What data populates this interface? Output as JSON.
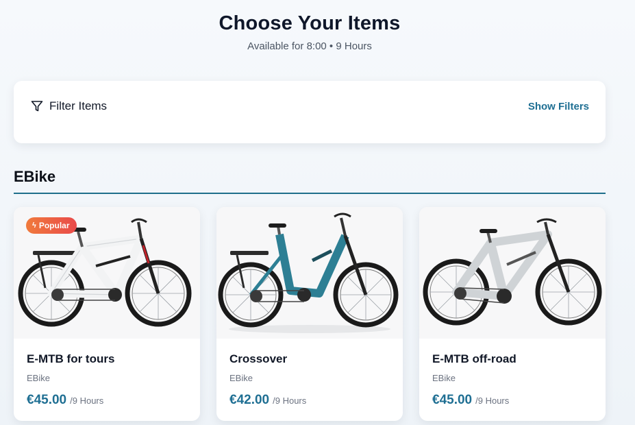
{
  "header": {
    "title": "Choose Your Items",
    "subtitle": "Available for 8:00 • 9 Hours"
  },
  "filter": {
    "label": "Filter Items",
    "icon": "filter-icon",
    "show_label": "Show Filters"
  },
  "section": {
    "title": "EBike"
  },
  "colors": {
    "accent": "#1f6f93",
    "badge_start": "#f07a3c",
    "badge_end": "#e94a4a",
    "bike_white": "#f2f3f4",
    "bike_teal": "#2d7f94",
    "bike_silver": "#cfd3d6"
  },
  "items": [
    {
      "badge": "Popular",
      "badge_icon": "lightning-icon",
      "name": "E-MTB for tours",
      "category": "EBike",
      "price": "€45.00",
      "per": "/9 Hours",
      "image": "white-hardtail-ebike-with-rack"
    },
    {
      "name": "Crossover",
      "category": "EBike",
      "price": "€42.00",
      "per": "/9 Hours",
      "image": "teal-step-through-ebike-with-rack"
    },
    {
      "name": "E-MTB off-road",
      "category": "EBike",
      "price": "€45.00",
      "per": "/9 Hours",
      "image": "silver-hardtail-emtb"
    }
  ]
}
